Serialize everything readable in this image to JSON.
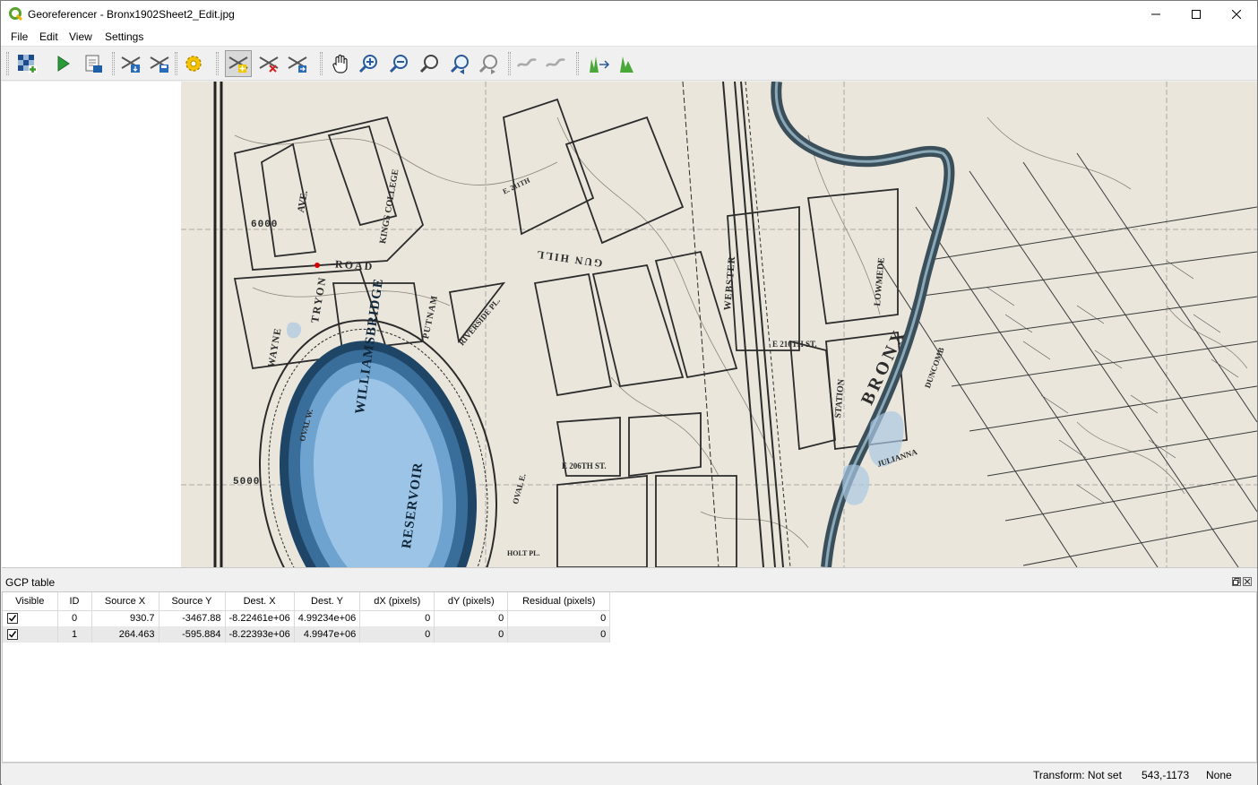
{
  "window": {
    "title": "Georeferencer - Bronx1902Sheet2_Edit.jpg"
  },
  "menu": {
    "items": [
      {
        "label": "File"
      },
      {
        "label": "Edit"
      },
      {
        "label": "View"
      },
      {
        "label": "Settings"
      }
    ]
  },
  "toolbar": {
    "buttons": [
      {
        "icon": "open-raster-icon"
      },
      {
        "icon": "start-georeferencing-icon"
      },
      {
        "icon": "generate-gdal-script-icon"
      },
      {
        "icon": "load-gcp-points-icon"
      },
      {
        "icon": "save-gcp-points-icon"
      },
      {
        "icon": "transformation-settings-icon"
      },
      {
        "icon": "add-point-icon"
      },
      {
        "icon": "delete-point-icon"
      },
      {
        "icon": "move-gcp-point-icon"
      },
      {
        "icon": "pan-icon"
      },
      {
        "icon": "zoom-in-icon"
      },
      {
        "icon": "zoom-out-icon"
      },
      {
        "icon": "zoom-to-layer-icon"
      },
      {
        "icon": "zoom-last-icon"
      },
      {
        "icon": "zoom-next-icon"
      },
      {
        "icon": "link-georeferencer-to-qgis-icon"
      },
      {
        "icon": "link-qgis-to-georeferencer-icon"
      },
      {
        "icon": "full-histogram-stretch-icon"
      },
      {
        "icon": "local-histogram-stretch-icon"
      }
    ]
  },
  "map_labels": {
    "road": "ROAD",
    "tryon": "TRYON",
    "putnam": "PUTNAM",
    "riverside": "RIVERSIDE PL.",
    "reservoir": "WILLIAMSBRIDGE",
    "reservoir2": "RESERVOIR",
    "wayne": "WAYNE",
    "kings_college": "KINGS COLLEGE",
    "gun_hill": "GUN HILL",
    "webster": "WEBSTER",
    "bronx": "BRONX",
    "station": "STATION",
    "lowmede": "LOWMEDE",
    "e206": "E 206TH ST.",
    "n6000": "6000",
    "n5000": "5000",
    "oval_w": "OVAL W.",
    "oval_e": "OVAL E.",
    "holt": "HOLT PL.",
    "julianna": "JULIANNA",
    "duncomb": "DUNCOMB",
    "ave1": "AVE.",
    "e211": "E. 211TH",
    "e210": "E 210TH ST."
  },
  "gcp_panel": {
    "title": "GCP table",
    "columns": [
      "Visible",
      "ID",
      "Source X",
      "Source Y",
      "Dest. X",
      "Dest. Y",
      "dX (pixels)",
      "dY (pixels)",
      "Residual (pixels)"
    ],
    "rows": [
      {
        "visible": true,
        "id": "0",
        "source_x": "930.7",
        "source_y": "-3467.88",
        "dest_x": "-8.22461e+06",
        "dest_y": "4.99234e+06",
        "dx": "0",
        "dy": "0",
        "residual": "0"
      },
      {
        "visible": true,
        "id": "1",
        "source_x": "264.463",
        "source_y": "-595.884",
        "dest_x": "-8.22393e+06",
        "dest_y": "4.9947e+06",
        "dx": "0",
        "dy": "0",
        "residual": "0"
      }
    ]
  },
  "statusbar": {
    "transform": "Transform: Not set",
    "coordinates": "543,-1173",
    "crs": "None"
  },
  "colors": {
    "map_paper": "#eae6dc",
    "map_ink": "#2b2b2b",
    "reservoir_water": "#7fb3df",
    "river_water": "#3a4f5a",
    "gcp_point": "#d40000"
  }
}
